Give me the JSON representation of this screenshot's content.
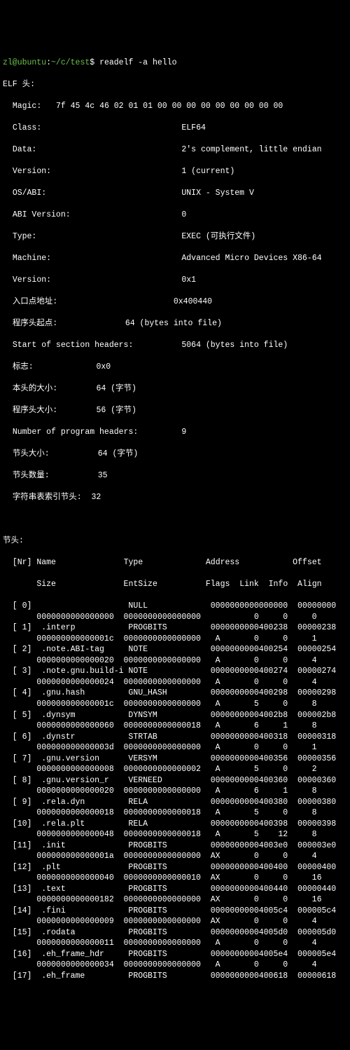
{
  "prompt": {
    "user": "zl@ubuntu",
    "path": "~/c/test",
    "sigil": "$",
    "command": "readelf -a hello"
  },
  "elf_header": {
    "title": "ELF 头:",
    "magic_label": "Magic:",
    "magic_value": "7f 45 4c 46 02 01 01 00 00 00 00 00 00 00 00 00",
    "class_label": "Class:",
    "class_value": "ELF64",
    "data_label": "Data:",
    "data_value": "2's complement, little endian",
    "version_label": "Version:",
    "version_value": "1 (current)",
    "osabi_label": "OS/ABI:",
    "osabi_value": "UNIX - System V",
    "abi_version_label": "ABI Version:",
    "abi_version_value": "0",
    "type_label": "Type:",
    "type_value": "EXEC (可执行文件)",
    "machine_label": "Machine:",
    "machine_value": "Advanced Micro Devices X86-64",
    "version2_label": "Version:",
    "version2_value": "0x1",
    "entry_label": "入口点地址:",
    "entry_value": "0x400440",
    "ph_off_label": "程序头起点:",
    "ph_off_value": "64 (bytes into file)",
    "sh_off_label": "Start of section headers:",
    "sh_off_value": "5064 (bytes into file)",
    "flags_label": "标志:",
    "flags_value": "0x0",
    "eh_size_label": "本头的大小:",
    "eh_size_value": "64 (字节)",
    "ph_size_label": "程序头大小:",
    "ph_size_value": "56 (字节)",
    "num_ph_label": "Number of program headers:",
    "num_ph_value": "9",
    "sh_size_label": "节头大小:",
    "sh_size_value": "64 (字节)",
    "num_sh_label": "节头数量:",
    "num_sh_value": "35",
    "str_idx_label": "字符串表索引节头:",
    "str_idx_value": "32"
  },
  "section_header": {
    "title": "节头:",
    "col_nr": "[Nr]",
    "col_name": "Name",
    "col_type": "Type",
    "col_address": "Address",
    "col_offset": "Offset",
    "col_size": "Size",
    "col_entsize": "EntSize",
    "col_flags": "Flags",
    "col_link": "Link",
    "col_info": "Info",
    "col_align": "Align",
    "rows": [
      {
        "nr": "[ 0]",
        "name": "",
        "type": "NULL",
        "addr": "0000000000000000",
        "off": "00000000",
        "size": "0000000000000000",
        "ent": "0000000000000000",
        "flg": "",
        "lk": "0",
        "inf": "0",
        "al": "0"
      },
      {
        "nr": "[ 1]",
        "name": ".interp",
        "type": "PROGBITS",
        "addr": "0000000000400238",
        "off": "00000238",
        "size": "000000000000001c",
        "ent": "0000000000000000",
        "flg": "A",
        "lk": "0",
        "inf": "0",
        "al": "1"
      },
      {
        "nr": "[ 2]",
        "name": ".note.ABI-tag",
        "type": "NOTE",
        "addr": "0000000000400254",
        "off": "00000254",
        "size": "0000000000000020",
        "ent": "0000000000000000",
        "flg": "A",
        "lk": "0",
        "inf": "0",
        "al": "4"
      },
      {
        "nr": "[ 3]",
        "name": ".note.gnu.build-i",
        "type": "NOTE",
        "addr": "0000000000400274",
        "off": "00000274",
        "size": "0000000000000024",
        "ent": "0000000000000000",
        "flg": "A",
        "lk": "0",
        "inf": "0",
        "al": "4"
      },
      {
        "nr": "[ 4]",
        "name": ".gnu.hash",
        "type": "GNU_HASH",
        "addr": "0000000000400298",
        "off": "00000298",
        "size": "000000000000001c",
        "ent": "0000000000000000",
        "flg": "A",
        "lk": "5",
        "inf": "0",
        "al": "8"
      },
      {
        "nr": "[ 5]",
        "name": ".dynsym",
        "type": "DYNSYM",
        "addr": "00000000004002b8",
        "off": "000002b8",
        "size": "0000000000000060",
        "ent": "0000000000000018",
        "flg": "A",
        "lk": "6",
        "inf": "1",
        "al": "8"
      },
      {
        "nr": "[ 6]",
        "name": ".dynstr",
        "type": "STRTAB",
        "addr": "0000000000400318",
        "off": "00000318",
        "size": "000000000000003d",
        "ent": "0000000000000000",
        "flg": "A",
        "lk": "0",
        "inf": "0",
        "al": "1"
      },
      {
        "nr": "[ 7]",
        "name": ".gnu.version",
        "type": "VERSYM",
        "addr": "0000000000400356",
        "off": "00000356",
        "size": "0000000000000008",
        "ent": "0000000000000002",
        "flg": "A",
        "lk": "5",
        "inf": "0",
        "al": "2"
      },
      {
        "nr": "[ 8]",
        "name": ".gnu.version_r",
        "type": "VERNEED",
        "addr": "0000000000400360",
        "off": "00000360",
        "size": "0000000000000020",
        "ent": "0000000000000000",
        "flg": "A",
        "lk": "6",
        "inf": "1",
        "al": "8"
      },
      {
        "nr": "[ 9]",
        "name": ".rela.dyn",
        "type": "RELA",
        "addr": "0000000000400380",
        "off": "00000380",
        "size": "0000000000000018",
        "ent": "0000000000000018",
        "flg": "A",
        "lk": "5",
        "inf": "0",
        "al": "8"
      },
      {
        "nr": "[10]",
        "name": ".rela.plt",
        "type": "RELA",
        "addr": "0000000000400398",
        "off": "00000398",
        "size": "0000000000000048",
        "ent": "0000000000000018",
        "flg": "A",
        "lk": "5",
        "inf": "12",
        "al": "8"
      },
      {
        "nr": "[11]",
        "name": ".init",
        "type": "PROGBITS",
        "addr": "00000000004003e0",
        "off": "000003e0",
        "size": "000000000000001a",
        "ent": "0000000000000000",
        "flg": "AX",
        "lk": "0",
        "inf": "0",
        "al": "4"
      },
      {
        "nr": "[12]",
        "name": ".plt",
        "type": "PROGBITS",
        "addr": "0000000000400400",
        "off": "00000400",
        "size": "0000000000000040",
        "ent": "0000000000000010",
        "flg": "AX",
        "lk": "0",
        "inf": "0",
        "al": "16"
      },
      {
        "nr": "[13]",
        "name": ".text",
        "type": "PROGBITS",
        "addr": "0000000000400440",
        "off": "00000440",
        "size": "0000000000000182",
        "ent": "0000000000000000",
        "flg": "AX",
        "lk": "0",
        "inf": "0",
        "al": "16"
      },
      {
        "nr": "[14]",
        "name": ".fini",
        "type": "PROGBITS",
        "addr": "00000000004005c4",
        "off": "000005c4",
        "size": "0000000000000009",
        "ent": "0000000000000000",
        "flg": "AX",
        "lk": "0",
        "inf": "0",
        "al": "4"
      },
      {
        "nr": "[15]",
        "name": ".rodata",
        "type": "PROGBITS",
        "addr": "00000000004005d0",
        "off": "000005d0",
        "size": "0000000000000011",
        "ent": "0000000000000000",
        "flg": "A",
        "lk": "0",
        "inf": "0",
        "al": "4"
      },
      {
        "nr": "[16]",
        "name": ".eh_frame_hdr",
        "type": "PROGBITS",
        "addr": "00000000004005e4",
        "off": "000005e4",
        "size": "0000000000000034",
        "ent": "0000000000000000",
        "flg": "A",
        "lk": "0",
        "inf": "0",
        "al": "4"
      },
      {
        "nr": "[17]",
        "name": ".eh_frame",
        "type": "PROGBITS",
        "addr": "0000000000400618",
        "off": "00000618"
      }
    ]
  }
}
